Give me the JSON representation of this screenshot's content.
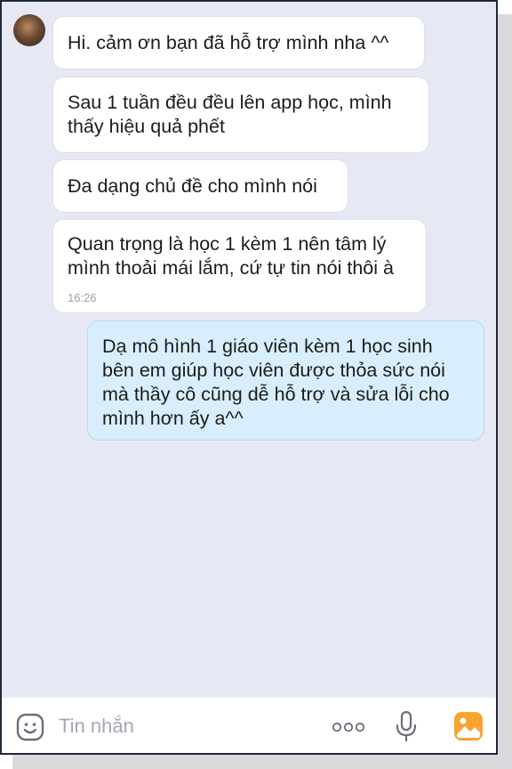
{
  "messages": [
    {
      "text": "Hi. cảm ơn bạn đã hỗ trợ mình nha ^^"
    },
    {
      "text": "Sau 1 tuần đều đều lên app học, mình\nthấy hiệu quả phết"
    },
    {
      "text": "Đa dạng chủ đề cho mình nói"
    },
    {
      "text": "Quan trọng là học 1 kèm 1 nên tâm lý\nmình thoải mái lắm, cứ tự tin nói thôi à",
      "time": "16:26"
    },
    {
      "text": "Dạ mô hình 1 giáo viên kèm 1 học sinh\nbên em giúp học viên được thỏa sức nói\nmà thầy cô cũng dễ hỗ trợ và sửa lỗi cho\nmình hơn ấy a^^"
    }
  ],
  "composer": {
    "placeholder": "Tin nhắn",
    "icons": [
      "sticker-icon",
      "more-icon",
      "microphone-icon",
      "image-icon"
    ]
  },
  "colors": {
    "incoming": "#ffffff",
    "outgoing": "#d9eefc",
    "background": "#e6e9f3",
    "image_icon": "#f6a531"
  }
}
